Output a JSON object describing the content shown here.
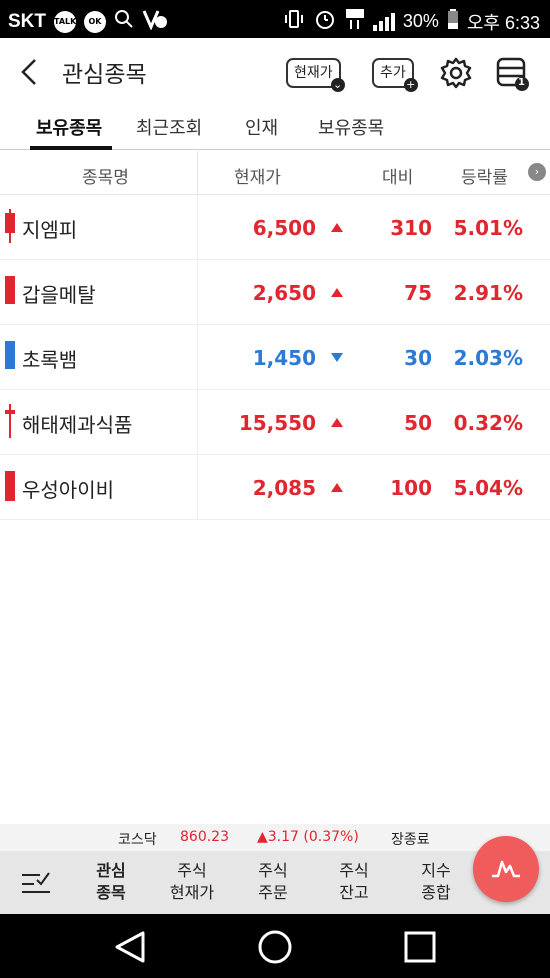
{
  "statusbar": {
    "carrier": "SKT",
    "icons": [
      "talk-icon",
      "ok-icon",
      "search-icon",
      "v3-icon",
      "vibrate-icon",
      "alarm-icon",
      "lte-icon",
      "signal-icon"
    ],
    "battery": "30%",
    "time": "오후 6:33"
  },
  "header": {
    "title": "관심종목",
    "current_price_btn": "현재가",
    "add_btn": "추가",
    "menu_badge": "1"
  },
  "tabs": [
    {
      "label": "보유종목",
      "active": true
    },
    {
      "label": "최근조회",
      "active": false
    },
    {
      "label": "인재",
      "active": false
    },
    {
      "label": "보유종목",
      "active": false
    }
  ],
  "table": {
    "columns": [
      "종목명",
      "현재가",
      "대비",
      "등락률"
    ],
    "rows": [
      {
        "name": "지엠피",
        "price": "6,500",
        "direction": "up",
        "diff": "310",
        "rate": "5.01%",
        "color": "#e0262f"
      },
      {
        "name": "갑을메탈",
        "price": "2,650",
        "direction": "up",
        "diff": "75",
        "rate": "2.91%",
        "color": "#e0262f"
      },
      {
        "name": "초록뱀",
        "price": "1,450",
        "direction": "down",
        "diff": "30",
        "rate": "2.03%",
        "color": "#2b7bd4"
      },
      {
        "name": "해태제과식품",
        "price": "15,550",
        "direction": "up",
        "diff": "50",
        "rate": "0.32%",
        "color": "#e0262f"
      },
      {
        "name": "우성아이비",
        "price": "2,085",
        "direction": "up",
        "diff": "100",
        "rate": "5.04%",
        "color": "#e0262f"
      }
    ]
  },
  "market": {
    "index_name": "코스닥",
    "value": "860.23",
    "change": "▲3.17 (0.37%)",
    "status": "장종료"
  },
  "bottom_nav": [
    {
      "line1": "관심",
      "line2": "종목",
      "active": true
    },
    {
      "line1": "주식",
      "line2": "현재가",
      "active": false
    },
    {
      "line1": "주식",
      "line2": "주문",
      "active": false
    },
    {
      "line1": "주식",
      "line2": "잔고",
      "active": false
    },
    {
      "line1": "지수",
      "line2": "종합",
      "active": false
    }
  ],
  "colors": {
    "up": "#e0262f",
    "down": "#2b7bd4",
    "fab": "#f05b5b"
  }
}
